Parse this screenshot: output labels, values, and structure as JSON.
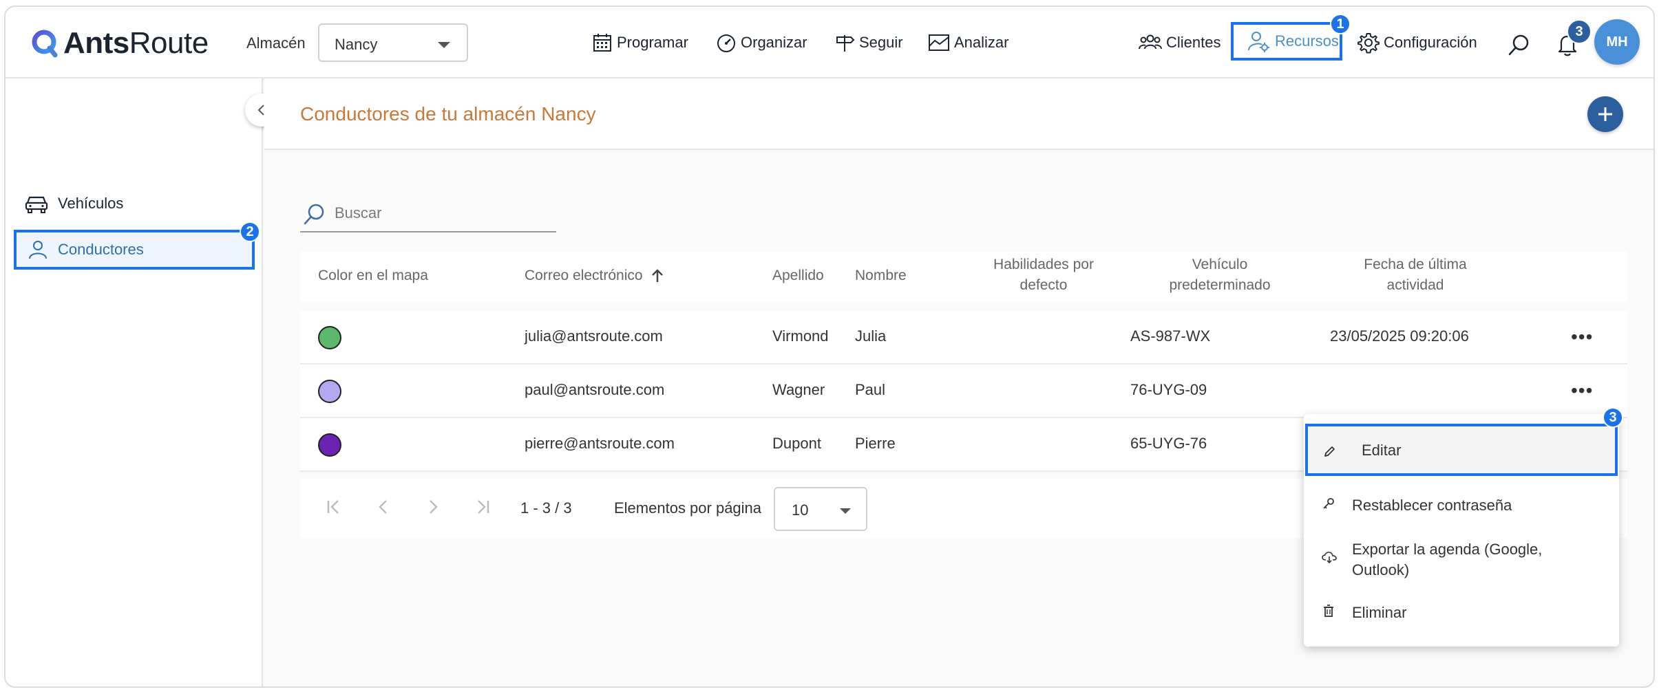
{
  "brand": {
    "bold": "Ants",
    "light": "Route"
  },
  "warehouse": {
    "label": "Almacén",
    "selected": "Nancy"
  },
  "nav": {
    "programar": "Programar",
    "organizar": "Organizar",
    "seguir": "Seguir",
    "analizar": "Analizar",
    "clientes": "Clientes",
    "recursos": "Recursos",
    "configuracion": "Configuración"
  },
  "notifications": {
    "count": "3"
  },
  "user": {
    "initials": "MH"
  },
  "markers": {
    "m1": "1",
    "m2": "2",
    "m3": "3"
  },
  "sidebar": {
    "vehiculos": "Vehículos",
    "conductores": "Conductores"
  },
  "page": {
    "title": "Conductores de tu almacén Nancy"
  },
  "search": {
    "placeholder": "Buscar"
  },
  "table": {
    "headers": {
      "color": "Color en el mapa",
      "email": "Correo electrónico",
      "apellido": "Apellido",
      "nombre": "Nombre",
      "habilidades_1": "Habilidades por",
      "habilidades_2": "defecto",
      "vehiculo_1": "Vehículo",
      "vehiculo_2": "predeterminado",
      "fecha_1": "Fecha de última",
      "fecha_2": "actividad"
    },
    "rows": [
      {
        "color": "#5cb86a",
        "email": "julia@antsroute.com",
        "apellido": "Virmond",
        "nombre": "Julia",
        "vehiculo": "AS-987-WX",
        "fecha": "23/05/2025 09:20:06"
      },
      {
        "color": "#b4a8ee",
        "email": "paul@antsroute.com",
        "apellido": "Wagner",
        "nombre": "Paul",
        "vehiculo": "76-UYG-09",
        "fecha": ""
      },
      {
        "color": "#6a22b0",
        "email": "pierre@antsroute.com",
        "apellido": "Dupont",
        "nombre": "Pierre",
        "vehiculo": "65-UYG-76",
        "fecha": ""
      }
    ]
  },
  "pager": {
    "range": "1 - 3 / 3",
    "per_page_label": "Elementos por página",
    "per_page": "10"
  },
  "menu": {
    "editar": "Editar",
    "restablecer": "Restablecer contraseña",
    "exportar": "Exportar la agenda (Google, Outlook)",
    "eliminar": "Eliminar"
  },
  "colors": {
    "accent": "#2b5f9e",
    "highlight": "#1a73e8",
    "title": "#c8793a"
  }
}
